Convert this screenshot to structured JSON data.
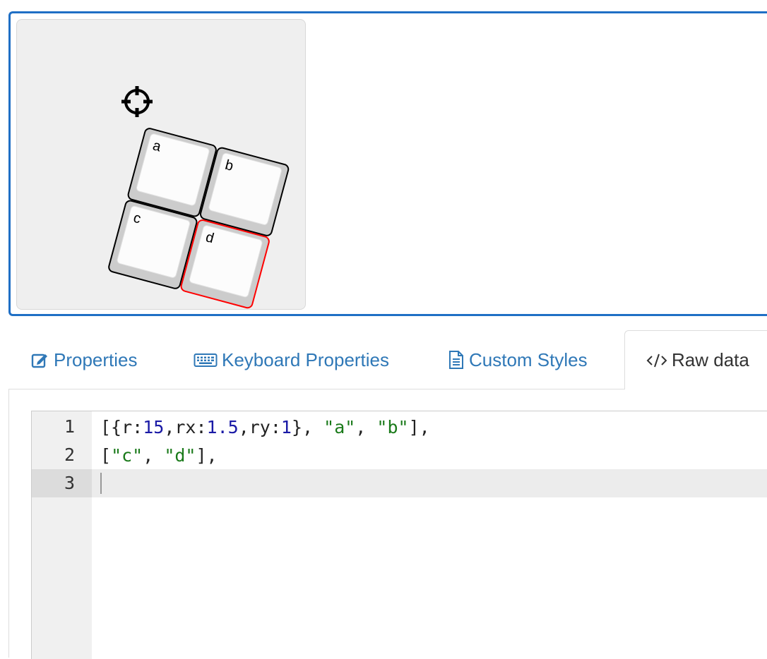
{
  "keys": [
    {
      "legend": "a",
      "selected": false
    },
    {
      "legend": "b",
      "selected": false
    },
    {
      "legend": "c",
      "selected": false
    },
    {
      "legend": "d",
      "selected": true
    }
  ],
  "tabs": [
    {
      "label": "Properties",
      "icon": "edit-icon",
      "active": false
    },
    {
      "label": "Keyboard Properties",
      "icon": "keyboard-icon",
      "active": false
    },
    {
      "label": "Custom Styles",
      "icon": "document-icon",
      "active": false
    },
    {
      "label": "Raw data",
      "icon": "code-icon",
      "active": true
    }
  ],
  "editor": {
    "lines": [
      {
        "number": "1",
        "tokens": [
          {
            "t": "[{r:",
            "k": "p"
          },
          {
            "t": "15",
            "k": "n"
          },
          {
            "t": ",rx:",
            "k": "p"
          },
          {
            "t": "1.5",
            "k": "n"
          },
          {
            "t": ",ry:",
            "k": "p"
          },
          {
            "t": "1",
            "k": "n"
          },
          {
            "t": "}, ",
            "k": "p"
          },
          {
            "t": "\"a\"",
            "k": "s"
          },
          {
            "t": ", ",
            "k": "p"
          },
          {
            "t": "\"b\"",
            "k": "s"
          },
          {
            "t": "],",
            "k": "p"
          }
        ]
      },
      {
        "number": "2",
        "tokens": [
          {
            "t": "[",
            "k": "p"
          },
          {
            "t": "\"c\"",
            "k": "s"
          },
          {
            "t": ", ",
            "k": "p"
          },
          {
            "t": "\"d\"",
            "k": "s"
          },
          {
            "t": "],",
            "k": "p"
          }
        ]
      },
      {
        "number": "3",
        "tokens": []
      }
    ]
  },
  "colors": {
    "accent": "#1f6fc5",
    "link": "#2f78b7",
    "selected_key": "#ff0000",
    "number_token": "#1a1aa6",
    "string_token": "#1a7a1a"
  }
}
